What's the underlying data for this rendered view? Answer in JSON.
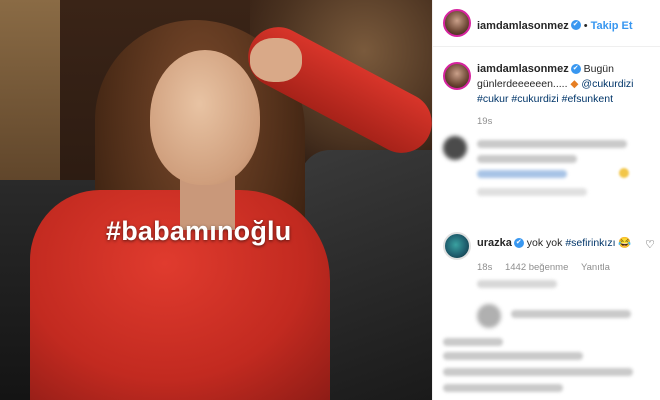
{
  "photo": {
    "overlay_text": "#babamınoğlu"
  },
  "header": {
    "username": "iamdamlasonmez",
    "verified_icon": "✔",
    "separator": "•",
    "follow_label": "Takip Et"
  },
  "caption": {
    "username": "iamdamlasonmez",
    "text_part1": "Bugün günlerdeeeeeen.....",
    "mention": "@cukurdizi",
    "hashtags": "#cukur #cukurdizi #efsunkent",
    "time": "19s"
  },
  "reply": {
    "username": "urazka",
    "text": "yok yok",
    "hashtag": "#sefirinkızı",
    "emoji": "😂",
    "time": "18s",
    "likes": "1442 beğenme",
    "reply_label": "Yanıtla"
  },
  "colors": {
    "accent": "#3897f0",
    "hashtag": "#003569",
    "dress": "#c22a20"
  }
}
